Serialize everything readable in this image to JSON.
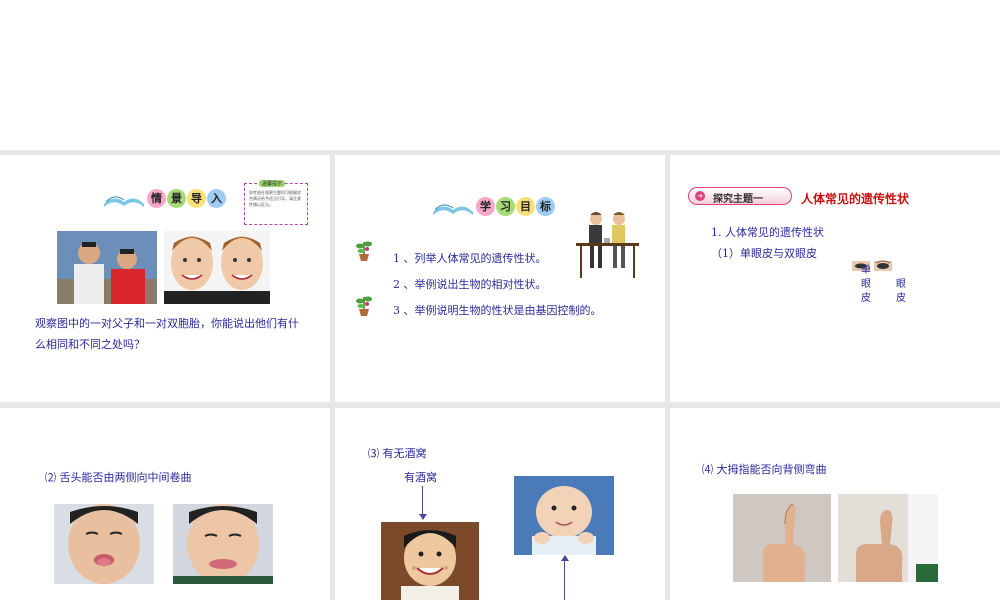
{
  "slide1": {
    "title_chars": [
      "情",
      "景",
      "导",
      "入"
    ],
    "tip_heading": "温馨提示",
    "tip_text": "如考虑在观察主题时可根据综合情况给予适当引导。请注意性情以区分。",
    "question": "观察图中的一对父子和一对双胞胎，你能说出他们有什么相同和不同之处吗？",
    "question_line1": "观察图中的一对父子和一对双胞胎，你能说出他们有什",
    "question_line2": "么相同和不同之处吗？"
  },
  "slide2": {
    "title_chars": [
      "学",
      "习",
      "目",
      "标"
    ],
    "goals": [
      "1 、列举人体常见的遗传性状。",
      "2 、举例说出生物的相对性状。",
      "3 、举例说明生物的性状是由基因控制的。"
    ]
  },
  "slide3": {
    "tag": "探究主题一",
    "title": "人体常见的遗传性状",
    "item1": "1. 人体常见的遗传性状",
    "item2": "（1）单眼皮与双眼皮",
    "label_a1": "单",
    "label_a2": "眼",
    "label_a3": "皮",
    "label_b1": "眼",
    "label_b2": "皮"
  },
  "slide4": {
    "caption": "⑵ 舌头能否由两侧向中间卷曲"
  },
  "slide5": {
    "caption": "⑶ 有无酒窝",
    "label_yes": "有酒窝"
  },
  "slide6": {
    "caption": "⑷ 大拇指能否向背侧弯曲"
  },
  "colors": {
    "text_blue": "#2a2a9a",
    "title_red": "#cc1111",
    "tag_pink": "#e0407a",
    "background": "#e7e7e7"
  }
}
